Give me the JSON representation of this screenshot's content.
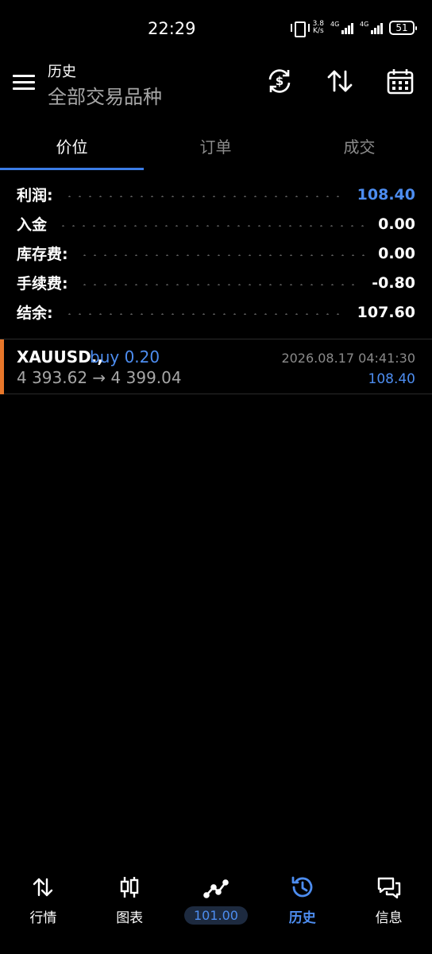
{
  "status_bar": {
    "time": "22:29",
    "speed_value": "3.8",
    "speed_unit": "K/s",
    "signal1_tag": "4G",
    "signal2_tag": "4G",
    "battery": "51"
  },
  "header": {
    "title": "历史",
    "subtitle": "全部交易品种",
    "icons": [
      "currency-refresh-icon",
      "sort-icon",
      "calendar-icon"
    ]
  },
  "tabs": [
    {
      "label": "价位",
      "active": true
    },
    {
      "label": "订单",
      "active": false
    },
    {
      "label": "成交",
      "active": false
    }
  ],
  "summary": [
    {
      "label": "利润:",
      "value": "108.40",
      "highlight": true
    },
    {
      "label": "入金",
      "value": "0.00",
      "highlight": false
    },
    {
      "label": "库存费:",
      "value": "0.00",
      "highlight": false
    },
    {
      "label": "手续费:",
      "value": "-0.80",
      "highlight": false
    },
    {
      "label": "结余:",
      "value": "107.60",
      "highlight": false
    }
  ],
  "trade": {
    "symbol": "XAUUSD.,",
    "side": "buy 0.20",
    "prices": "4 393.62 → 4 399.04",
    "time": "2026.08.17 04:41:30",
    "profit": "108.40"
  },
  "bottom_nav": [
    {
      "label": "行情",
      "icon": "quotes-icon",
      "active": false
    },
    {
      "label": "图表",
      "icon": "chart-icon",
      "active": false
    },
    {
      "label": "101.00",
      "icon": "trade-icon",
      "active": false
    },
    {
      "label": "历史",
      "icon": "history-icon",
      "active": true
    },
    {
      "label": "信息",
      "icon": "messages-icon",
      "active": false
    }
  ],
  "colors": {
    "accent": "#4d8df0",
    "tab_underline": "#3b7ce6",
    "trade_bar": "#e8772a",
    "background": "#000000"
  }
}
